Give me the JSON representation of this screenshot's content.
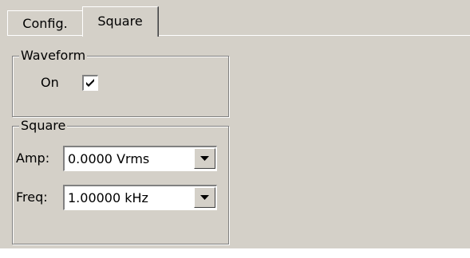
{
  "tabs": [
    {
      "label": "Config.",
      "selected": false
    },
    {
      "label": "Square",
      "selected": true
    }
  ],
  "waveform": {
    "group_title": "Waveform",
    "on_label": "On",
    "on_checked": true
  },
  "square": {
    "group_title": "Square",
    "amp_label": "Amp:",
    "amp_value": "0.0000 Vrms",
    "freq_label": "Freq:",
    "freq_value": "1.00000 kHz"
  },
  "icons": {
    "checkbox_mark": "checkmark-icon",
    "dropdown": "chevron-down-icon"
  },
  "colors": {
    "face": "#d4d0c8",
    "shadow": "#808080",
    "highlight": "#ffffff"
  }
}
